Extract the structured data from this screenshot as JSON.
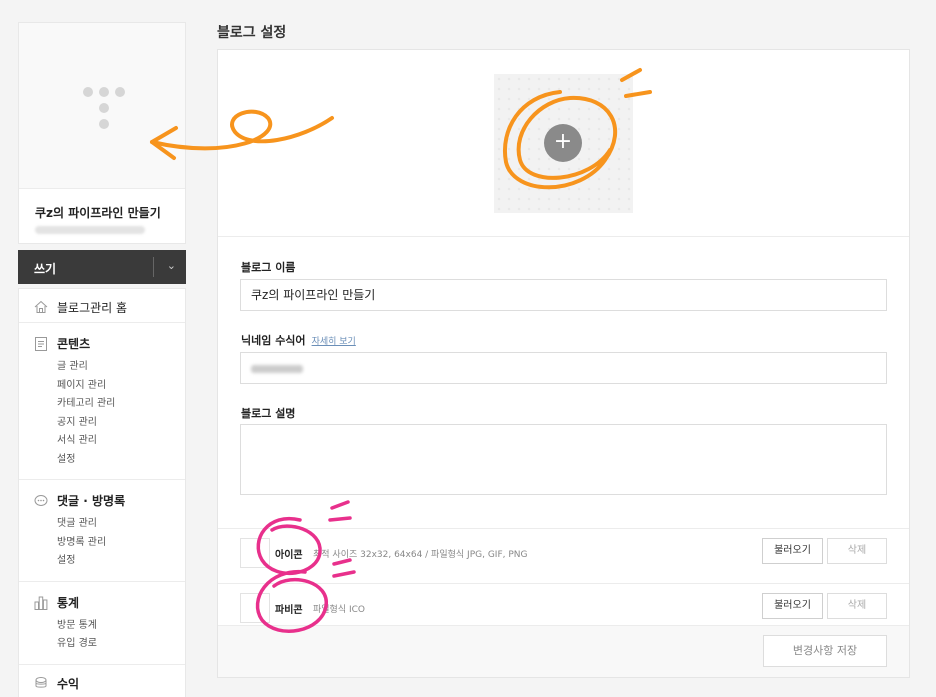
{
  "page": {
    "title": "블로그 설정"
  },
  "sidebar": {
    "blog_name": "쿠z의 파이프라인 만들기",
    "write_label": "쓰기",
    "home_label": "블로그관리 홈",
    "groups": [
      {
        "title": "콘텐츠",
        "icon": "document-icon",
        "items": [
          "글 관리",
          "페이지 관리",
          "카테고리 관리",
          "공지 관리",
          "서식 관리",
          "설정"
        ]
      },
      {
        "title": "댓글 · 방명록",
        "icon": "chat-icon",
        "items": [
          "댓글 관리",
          "방명록 관리",
          "설정"
        ]
      },
      {
        "title": "통계",
        "icon": "bar-chart-icon",
        "items": [
          "방문 통계",
          "유입 경로"
        ]
      }
    ],
    "revenue_label": "수익"
  },
  "form": {
    "blog_name_label": "블로그 이름",
    "blog_name_value": "쿠z의 파이프라인 만들기",
    "nickname_label": "닉네임 수식어",
    "nickname_help_link": "자세히 보기",
    "description_label": "블로그 설명",
    "icon_row": {
      "label": "아이콘",
      "desc": "최적 사이즈 32x32, 64x64 / 파일형식 JPG, GIF, PNG",
      "load": "불러오기",
      "delete": "삭제"
    },
    "favicon_row": {
      "label": "파비콘",
      "desc": "파일형식 ICO",
      "load": "불러오기",
      "delete": "삭제"
    },
    "save_label": "변경사항 저장"
  },
  "colors": {
    "annotation_orange": "#f7941d",
    "annotation_pink": "#e8308c",
    "write_bar": "#3a3a3a"
  }
}
